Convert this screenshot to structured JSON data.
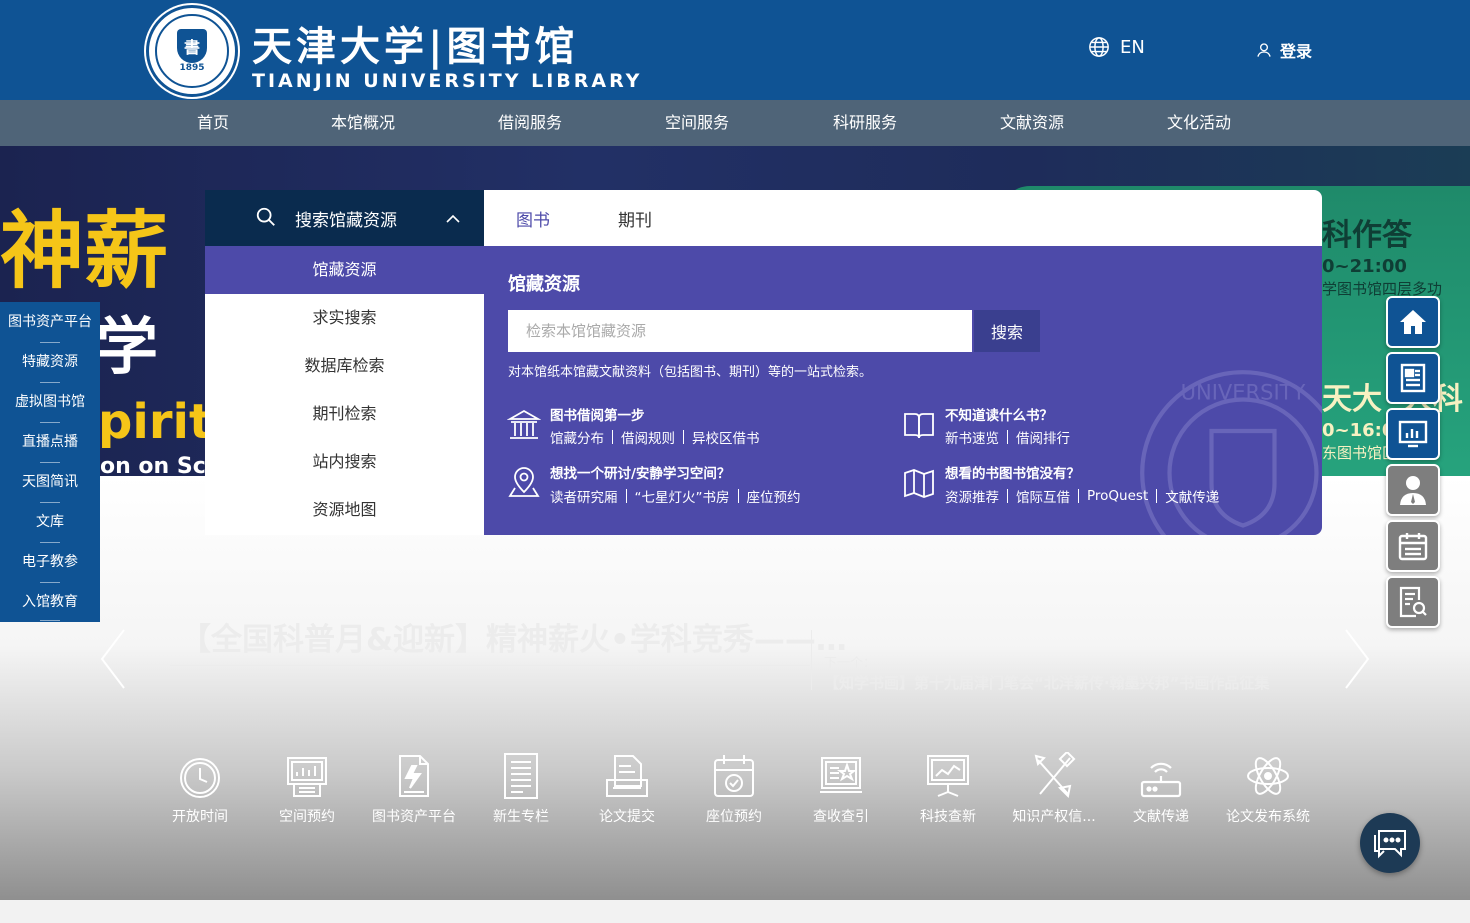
{
  "header": {
    "logo_cn": "天津大学|图书馆",
    "logo_en": "TIANJIN UNIVERSITY LIBRARY",
    "seal_year": "1895",
    "lang_label": "EN",
    "login_label": "登录"
  },
  "nav": [
    "首页",
    "本馆概况",
    "借阅服务",
    "空间服务",
    "科研服务",
    "文献资源",
    "文化活动"
  ],
  "banner": {
    "left_big": "神薪",
    "left_mid": "学",
    "left_en": "pirit",
    "left_small": "on on Sc",
    "right_title": "科作答",
    "right_time": "0~21:00",
    "right_place": "学图书馆四层多功",
    "right_title2": "天大",
    "right_title2b": "人科",
    "right_time2": "0~16:00",
    "right_place2": "东图书馆区一层"
  },
  "left_sidebar": [
    "图书资产平台",
    "特藏资源",
    "虚拟图书馆",
    "直播点播",
    "天图简讯",
    "文库",
    "电子教参",
    "入馆教育"
  ],
  "search_panel": {
    "head_title": "搜索馆藏资源",
    "menu": [
      "馆藏资源",
      "求实搜索",
      "数据库检索",
      "期刊检索",
      "站内搜索",
      "资源地图"
    ],
    "active_menu": 0,
    "tabs": [
      "图书",
      "期刊"
    ],
    "active_tab": 0,
    "section_title": "馆藏资源",
    "input_placeholder": "检索本馆馆藏资源",
    "search_button": "搜索",
    "description": "对本馆纸本馆藏文献资料（包括图书、期刊）等的一站式检索。",
    "blocks": [
      {
        "icon": "library-building-icon",
        "title": "图书借阅第一步",
        "links": [
          "馆藏分布",
          "借阅规则",
          "异校区借书"
        ]
      },
      {
        "icon": "open-book-icon",
        "title": "不知道读什么书？",
        "links": [
          "新书速览",
          "借阅排行"
        ]
      },
      {
        "icon": "map-pin-icon",
        "title": "想找一个研讨/安静学习空间？",
        "links": [
          "读者研究厢",
          "“七星灯火”书房",
          "座位预约"
        ]
      },
      {
        "icon": "map-icon",
        "title": "想看的书图书馆没有？",
        "links": [
          "资源推荐",
          "馆际互借",
          "ProQuest",
          "文献传递"
        ]
      }
    ]
  },
  "slide": {
    "title": "【全国科普月&迎新】精神薪火•学科竞秀——…",
    "next_label": "下一个：",
    "next_title": "【知学书画】第十九届津门笔会“北洋薪传·翰墨兴邦”书画作品征集"
  },
  "quick_links": [
    {
      "icon": "clock-icon",
      "label": "开放时间"
    },
    {
      "icon": "space-booking-icon",
      "label": "空间预约"
    },
    {
      "icon": "asset-platform-icon",
      "label": "图书资产平台"
    },
    {
      "icon": "freshman-column-icon",
      "label": "新生专栏"
    },
    {
      "icon": "thesis-submit-icon",
      "label": "论文提交"
    },
    {
      "icon": "seat-booking-icon",
      "label": "座位预约"
    },
    {
      "icon": "citation-search-icon",
      "label": "查收查引"
    },
    {
      "icon": "novelty-search-icon",
      "label": "科技查新"
    },
    {
      "icon": "ip-info-icon",
      "label": "知识产权信..."
    },
    {
      "icon": "document-delivery-icon",
      "label": "文献传递"
    },
    {
      "icon": "thesis-publish-icon",
      "label": "论文发布系统"
    }
  ],
  "right_float": [
    {
      "icon": "home-icon",
      "style": "blue"
    },
    {
      "icon": "news-icon",
      "style": "blue"
    },
    {
      "icon": "statistics-icon",
      "style": "blue"
    },
    {
      "icon": "librarian-icon",
      "style": "gray"
    },
    {
      "icon": "calendar-icon",
      "style": "gray"
    },
    {
      "icon": "document-search-icon",
      "style": "gray"
    }
  ],
  "colors": {
    "header_blue": "#0f5394",
    "nav_gray": "#4f6478",
    "panel_purple": "#4d4aa9",
    "panel_head_dark": "#0a2b4e",
    "tab_active": "#4d4aa9"
  }
}
